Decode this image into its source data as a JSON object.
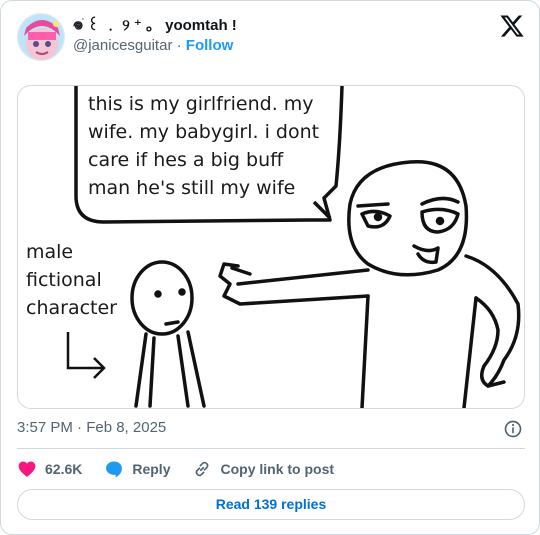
{
  "author": {
    "display_name": "𖦹ֹ ꒰ ﹒ ୨ ⁺ 。 yoomtah !",
    "handle": "@janicesguitar",
    "separator": "·",
    "follow_label": "Follow"
  },
  "comic": {
    "speech_bubble_lines": [
      "this is my girlfriend. my",
      "wife. my babygirl. i dont",
      "care if hes a big buff",
      "man he's still my wife"
    ],
    "side_label_lines": [
      "male",
      "fictional",
      "character"
    ]
  },
  "post": {
    "timestamp": "3:57 PM · Feb 8, 2025"
  },
  "actions": {
    "like_count": "62.6K",
    "reply_label": "Reply",
    "copy_link_label": "Copy link to post"
  },
  "read_replies_label": "Read 139 replies",
  "colors": {
    "like": "#f91880",
    "reply": "#1d9bf0",
    "follow": "#1d9bf0",
    "link_button": "#006fd6",
    "muted": "#536471"
  }
}
